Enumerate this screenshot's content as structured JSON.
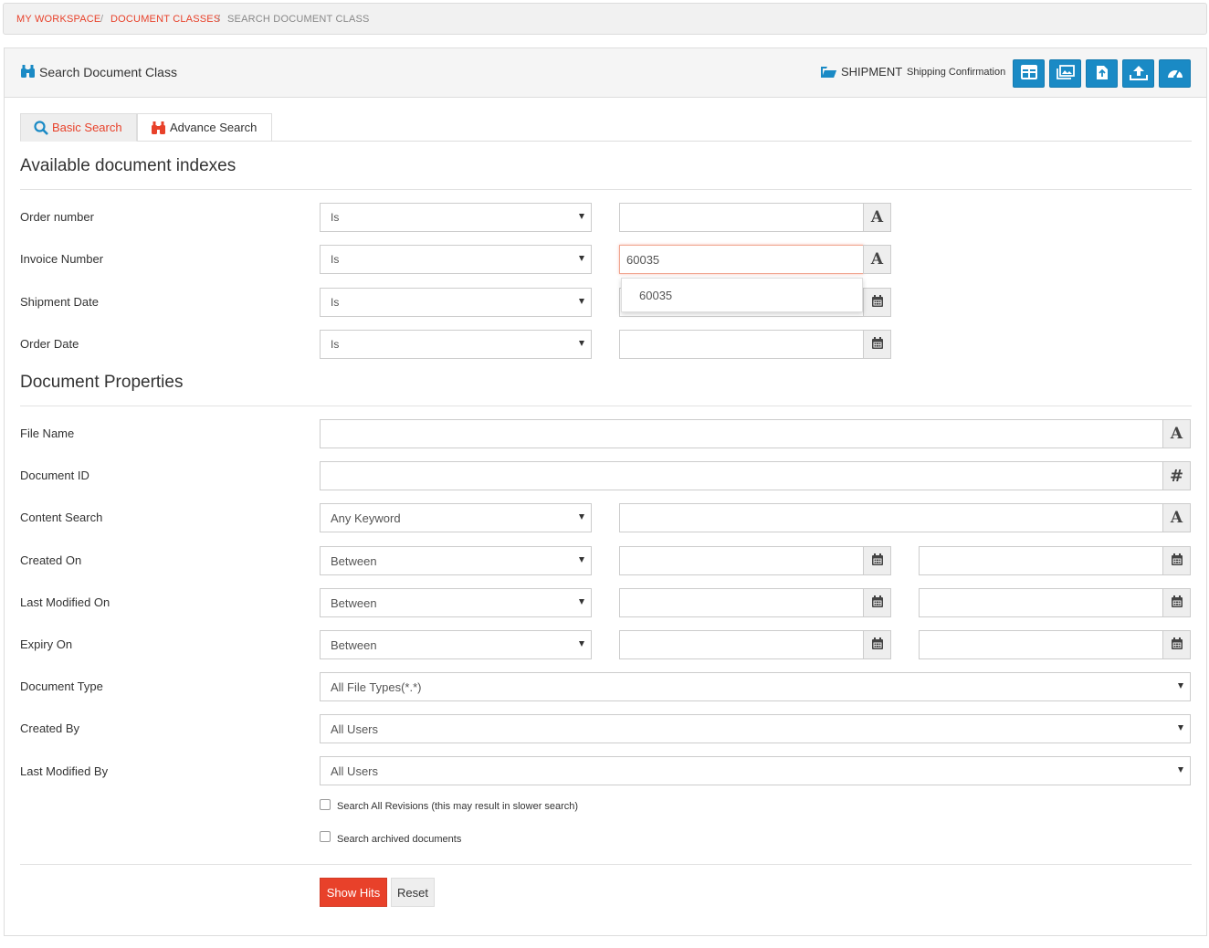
{
  "breadcrumb": {
    "items": [
      "MY WORKSPACE",
      "DOCUMENT CLASSES",
      "SEARCH DOCUMENT CLASS"
    ],
    "separator": "/"
  },
  "header": {
    "title": "Search Document Class",
    "class_name": "SHIPMENT",
    "class_description": "Shipping Confirmation",
    "toolbar_icons": [
      "table-grid-icon",
      "image-gallery-icon",
      "file-upload-icon",
      "upload-icon",
      "dashboard-icon"
    ]
  },
  "tabs": [
    {
      "label": "Basic Search",
      "icon": "search-icon",
      "active": true
    },
    {
      "label": "Advance Search",
      "icon": "binoculars-icon",
      "active": false
    }
  ],
  "indexes": {
    "heading": "Available document indexes",
    "rows": [
      {
        "label": "Order number",
        "operator": "Is",
        "value": "",
        "addon": "A"
      },
      {
        "label": "Invoice Number",
        "operator": "Is",
        "value": "60035",
        "addon": "A"
      },
      {
        "label": "Shipment Date",
        "operator": "Is",
        "value": "",
        "addon": "calendar-icon"
      },
      {
        "label": "Order Date",
        "operator": "Is",
        "value": "",
        "addon": "calendar-icon"
      }
    ],
    "autocomplete": [
      "60035"
    ]
  },
  "properties": {
    "heading": "Document Properties",
    "file_name": {
      "label": "File Name",
      "value": "",
      "addon": "A"
    },
    "document_id": {
      "label": "Document ID",
      "value": "",
      "addon": "#"
    },
    "content_search": {
      "label": "Content Search",
      "operator": "Any Keyword",
      "value": "",
      "addon": "A"
    },
    "created_on": {
      "label": "Created On",
      "operator": "Between",
      "from": "",
      "to": ""
    },
    "last_modified_on": {
      "label": "Last Modified On",
      "operator": "Between",
      "from": "",
      "to": ""
    },
    "expiry_on": {
      "label": "Expiry On",
      "operator": "Between",
      "from": "",
      "to": ""
    },
    "document_type": {
      "label": "Document Type",
      "value": "All File Types(*.*)"
    },
    "created_by": {
      "label": "Created By",
      "value": "All Users"
    },
    "last_modified_by": {
      "label": "Last Modified By",
      "value": "All Users"
    }
  },
  "options": {
    "search_all_revisions": {
      "label": "Search All Revisions (this may result in slower search)",
      "checked": false
    },
    "search_archived": {
      "label": "Search archived documents",
      "checked": false
    }
  },
  "actions": {
    "show_hits": "Show Hits",
    "reset": "Reset"
  },
  "colors": {
    "accent": "#e8412a",
    "toolbar_blue": "#1a8ac5",
    "link_icon_blue": "#1a8ac5"
  }
}
